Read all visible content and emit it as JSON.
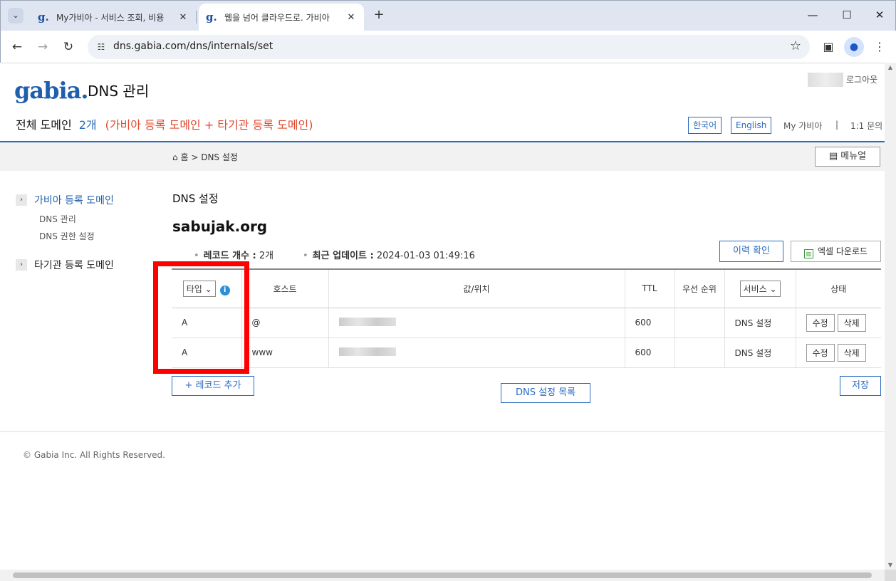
{
  "browser": {
    "tabs": [
      {
        "title": "My가비아 - 서비스 조회, 비용",
        "favicon": "g."
      },
      {
        "title": "웹을 넘어 클라우드로. 가비아",
        "favicon": "g."
      }
    ],
    "url": "dns.gabia.com/dns/internals/set"
  },
  "header": {
    "logo": "gabia",
    "logo_dot": ".",
    "app_title": "DNS 관리",
    "logout": "로그아웃",
    "summary_label": "전체 도메인",
    "summary_count": "2개",
    "summary_detail": "(가비아 등록 도메인 + 타기관 등록 도메인)",
    "lang_ko": "한국어",
    "lang_en": "English",
    "my_gabia": "My 가비아",
    "separator": "|",
    "inquiry": "1:1 문의"
  },
  "breadcrumb": {
    "home": "홈",
    "sep": ">",
    "current": "DNS 설정",
    "manual": "메뉴얼"
  },
  "sidebar": {
    "group1": "가비아 등록 도메인",
    "sub1": "DNS 관리",
    "sub2": "DNS 권한 설정",
    "group2": "타기관 등록 도메인"
  },
  "main": {
    "section_title": "DNS 설정",
    "domain": "sabujak.org",
    "record_count_label": "레코드 개수 :",
    "record_count": "2개",
    "last_update_label": "최근 업데이트 :",
    "last_update": "2024-01-03 01:49:16",
    "history_btn": "이력 확인",
    "excel_btn": "엑셀 다운로드"
  },
  "table": {
    "headers": {
      "type": "타입",
      "host": "호스트",
      "value": "값/위치",
      "ttl": "TTL",
      "priority": "우선 순위",
      "service": "서비스",
      "status": "상태"
    },
    "rows": [
      {
        "type": "A",
        "host": "@",
        "ttl": "600",
        "service": "DNS 설정",
        "edit": "수정",
        "delete": "삭제"
      },
      {
        "type": "A",
        "host": "www",
        "ttl": "600",
        "service": "DNS 설정",
        "edit": "수정",
        "delete": "삭제"
      }
    ]
  },
  "actions": {
    "add_record": "+ 레코드 추가",
    "dns_list": "DNS 설정 목록",
    "save": "저장"
  },
  "footer": {
    "copyright": "© Gabia Inc. All Rights Reserved."
  },
  "colors": {
    "accent": "#2a6ac1",
    "highlight": "#ff0000",
    "summary_detail": "#e0492f"
  }
}
